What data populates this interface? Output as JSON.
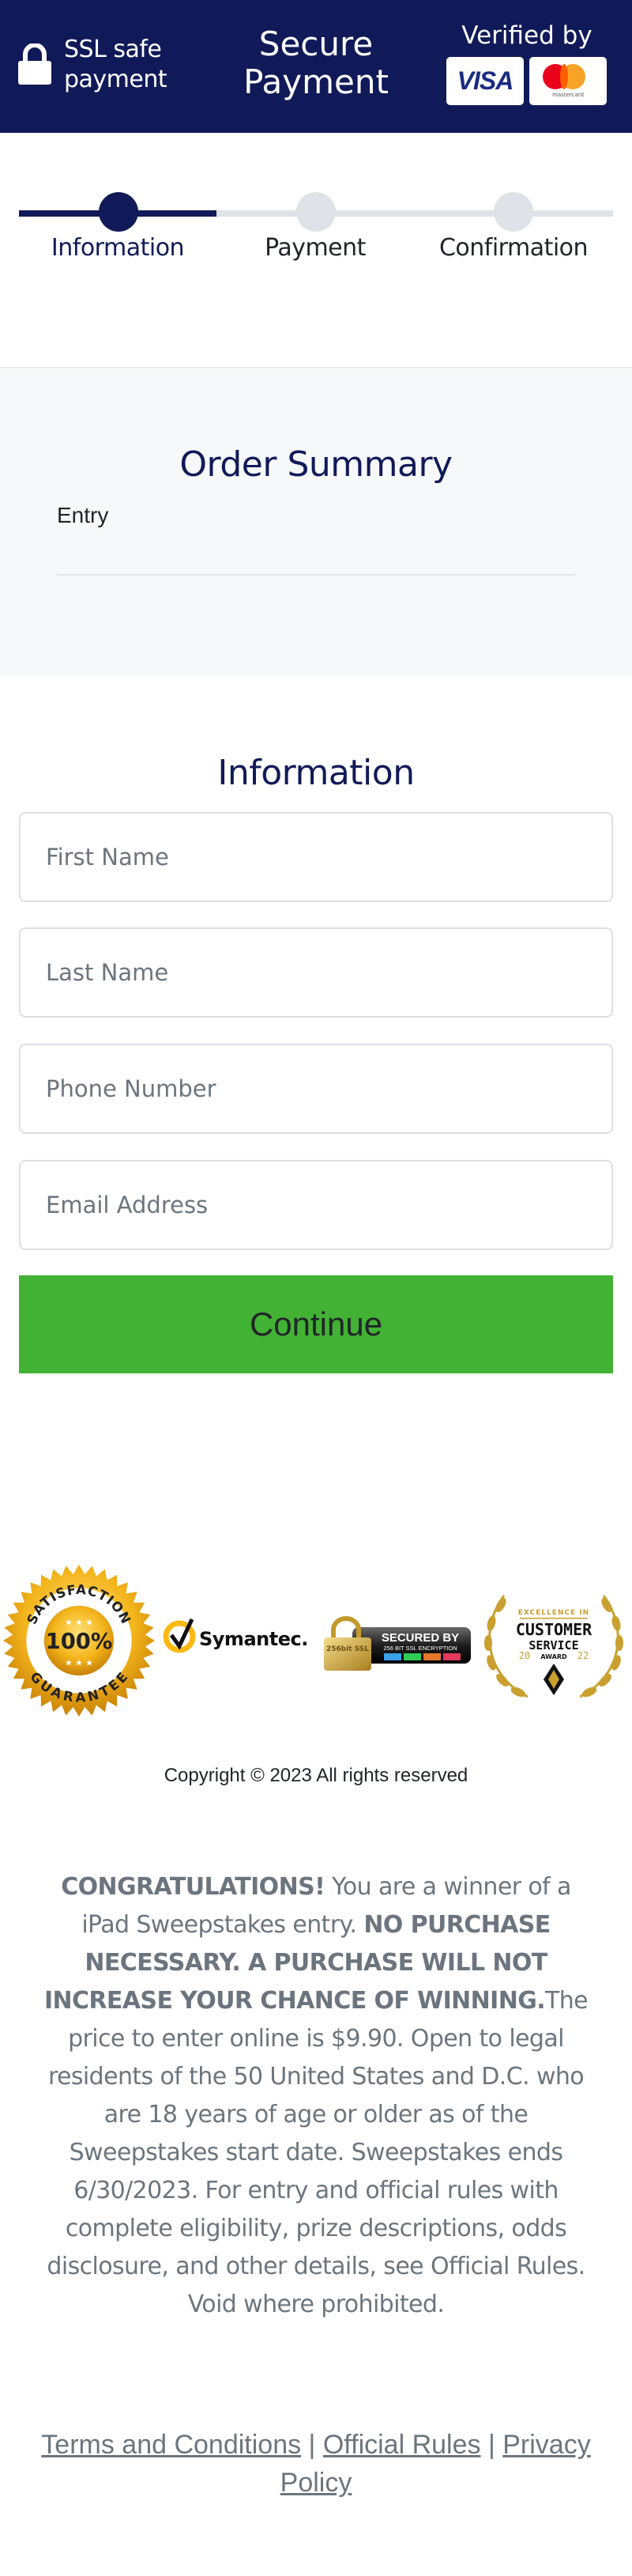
{
  "header": {
    "ssl_line1": "SSL safe",
    "ssl_line2": "payment",
    "secure_line1": "Secure",
    "secure_line2": "Payment",
    "verified_by": "Verified by",
    "visa_label": "VISA",
    "mastercard_label": "mastercard",
    "bg_color": "#111a58"
  },
  "stepper": {
    "steps": [
      {
        "label": "Information",
        "state": "active"
      },
      {
        "label": "Payment",
        "state": "inactive"
      },
      {
        "label": "Confirmation",
        "state": "inactive"
      }
    ],
    "progress_fraction": 0.33
  },
  "order_summary": {
    "title": "Order Summary",
    "items": [
      {
        "label": "Entry"
      }
    ]
  },
  "form": {
    "title": "Information",
    "fields": [
      {
        "name": "first_name",
        "placeholder": "First Name",
        "value": ""
      },
      {
        "name": "last_name",
        "placeholder": "Last Name",
        "value": ""
      },
      {
        "name": "phone",
        "placeholder": "Phone Number",
        "value": ""
      },
      {
        "name": "email",
        "placeholder": "Email Address",
        "value": ""
      }
    ],
    "continue_label": "Continue",
    "continue_color": "#42b234"
  },
  "badges": {
    "seal_top": "SATISFACTION",
    "seal_center": "100%",
    "seal_bottom": "GUARANTEE",
    "symantec": "Symantec.",
    "ssl_secured": "SECURED BY",
    "ssl_sub": "256 BIT SSL ENCRYPTION",
    "ssl_lock": "256bit SSL",
    "award_top": "EXCELLENCE IN",
    "award_main": "CUSTOMER",
    "award_sub": "SERVICE",
    "award_award": "AWARD",
    "award_year_left": "20",
    "award_year_right": "22"
  },
  "copyright": "Copyright © 2023 All rights reserved",
  "disclaimer": {
    "congrats": "CONGRATULATIONS!",
    "text1": " You are a winner of a iPad Sweepstakes entry. ",
    "bold2": "NO PURCHASE NECESSARY. A PURCHASE WILL NOT INCREASE YOUR CHANCE OF WINNING.",
    "text2": "The price to enter online is $9.90. Open to legal residents of the 50 United States and D.C. who are 18 years of age or older as of the Sweepstakes start date. Sweepstakes ends 6/30/2023. For entry and official rules with complete eligibility, prize descriptions, odds disclosure, and other details, see Official Rules. Void where prohibited."
  },
  "footer": {
    "links": [
      "Terms and Conditions",
      "Official Rules",
      "Privacy Policy"
    ],
    "separator": " | "
  }
}
